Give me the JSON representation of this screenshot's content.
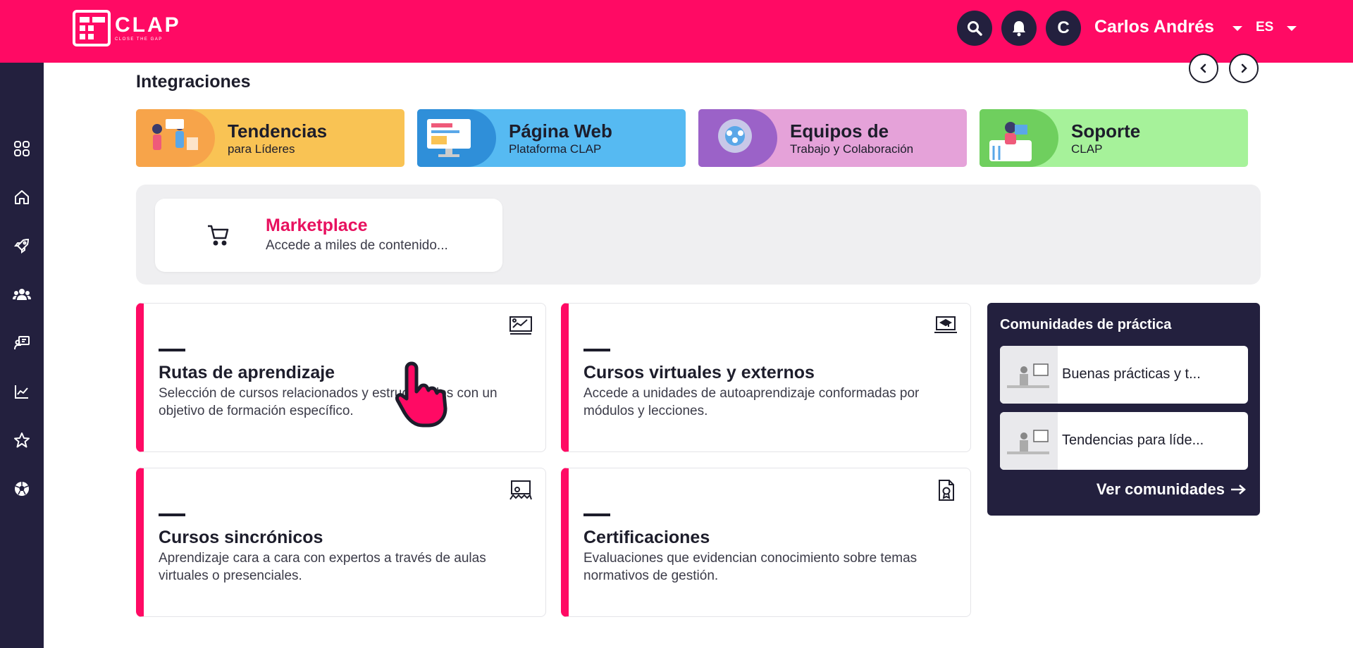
{
  "header": {
    "logo_word": "CLAP",
    "logo_tagline": "CLOSE THE GAP",
    "user_initial": "C",
    "user_name": "Carlos Andrés",
    "language": "ES"
  },
  "sidebar": {
    "items": [
      {
        "icon": "grid-icon"
      },
      {
        "icon": "home-icon"
      },
      {
        "icon": "rocket-icon"
      },
      {
        "icon": "users-icon"
      },
      {
        "icon": "teacher-icon"
      },
      {
        "icon": "chart-icon"
      },
      {
        "icon": "star-icon"
      },
      {
        "icon": "soccer-ball-icon"
      }
    ]
  },
  "integrations": {
    "title": "Integraciones",
    "items": [
      {
        "title": "Tendencias",
        "subtitle": "para Líderes",
        "color": "#f9c354"
      },
      {
        "title": "Página Web",
        "subtitle": "Plataforma CLAP",
        "color": "#56baf2"
      },
      {
        "title": "Equipos de",
        "subtitle": "Trabajo y Colaboración",
        "color": "#e5a2d9"
      },
      {
        "title": "Soporte",
        "subtitle": "CLAP",
        "color": "#a6f29a"
      }
    ]
  },
  "marketplace": {
    "title": "Marketplace",
    "subtitle": "Accede a miles de contenido..."
  },
  "features": [
    {
      "title": "Rutas de aprendizaje",
      "desc": "Selección de cursos relacionados y estructurados con un objetivo de formación específico."
    },
    {
      "title": "Cursos virtuales y externos",
      "desc": "Accede a unidades de autoaprendizaje conformadas por módulos y lecciones."
    },
    {
      "title": "Cursos sincrónicos",
      "desc": "Aprendizaje cara a cara con expertos a través de aulas virtuales o presenciales."
    },
    {
      "title": "Certificaciones",
      "desc": "Evaluaciones que evidencian conocimiento sobre temas normativos de gestión."
    }
  ],
  "communities": {
    "title": "Comunidades de práctica",
    "items": [
      "Buenas prácticas y t...",
      "Tendencias para líde..."
    ],
    "link": "Ver comunidades"
  },
  "colors": {
    "brand": "#ff0a64",
    "navy": "#23203e",
    "market_accent": "#e8115f"
  }
}
